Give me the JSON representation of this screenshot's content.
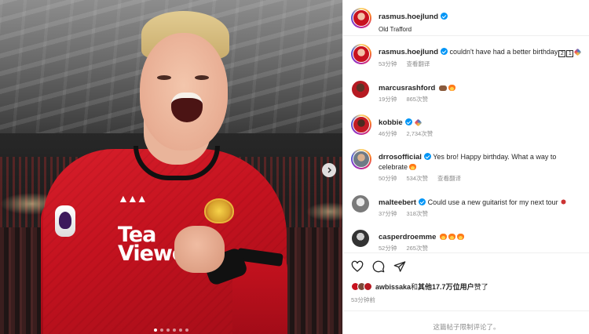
{
  "post": {
    "author": "rasmus.hoejlund",
    "location": "Old Trafford",
    "caption_author": "rasmus.hoejlund",
    "caption_text": "couldn't have had a better birthday",
    "caption_emoji_boxes": [
      "2",
      "1"
    ],
    "caption_time": "53分钟",
    "caption_translate": "查看翻译",
    "sponsor_line1": "Tea",
    "sponsor_line2": "Viewe",
    "sponsor_prefix": "Team"
  },
  "comments": [
    {
      "user": "marcusrashford",
      "verified": false,
      "text": "",
      "emojis": [
        "hand",
        "fire"
      ],
      "time": "19分钟",
      "likes": "865次赞"
    },
    {
      "user": "kobbie",
      "verified": true,
      "text": "",
      "emojis": [
        "party"
      ],
      "time": "46分钟",
      "likes": "2,734次赞"
    },
    {
      "user": "drrosofficial",
      "verified": true,
      "text": "Yes bro! Happy birthday. What a way to",
      "text2": "celebrate",
      "emojis": [
        "fire"
      ],
      "time": "50分钟",
      "likes": "534次赞",
      "translate": "查看翻译"
    },
    {
      "user": "malteebert",
      "verified": true,
      "text": "Could use a new guitarist for my next tour",
      "emojis": [
        "guitar"
      ],
      "time": "37分钟",
      "likes": "318次赞"
    },
    {
      "user": "casperdroemme",
      "verified": false,
      "text": "",
      "emojis": [
        "fire",
        "fire",
        "fire"
      ],
      "time": "52分钟",
      "likes": "265次赞"
    }
  ],
  "actions": {
    "like_icon": "heart-icon",
    "comment_icon": "comment-icon",
    "share_icon": "share-icon"
  },
  "likes": {
    "user": "awbissaka",
    "and_text": "和",
    "others": "其他17.7万位用户",
    "suffix": "赞了"
  },
  "post_time": "53分钟前",
  "comments_limited": "这篇帖子限制评论了。",
  "colors": {
    "verified": "#0095f6",
    "jersey_red": "#c4121f",
    "meta_gray": "#8e8e8e"
  }
}
